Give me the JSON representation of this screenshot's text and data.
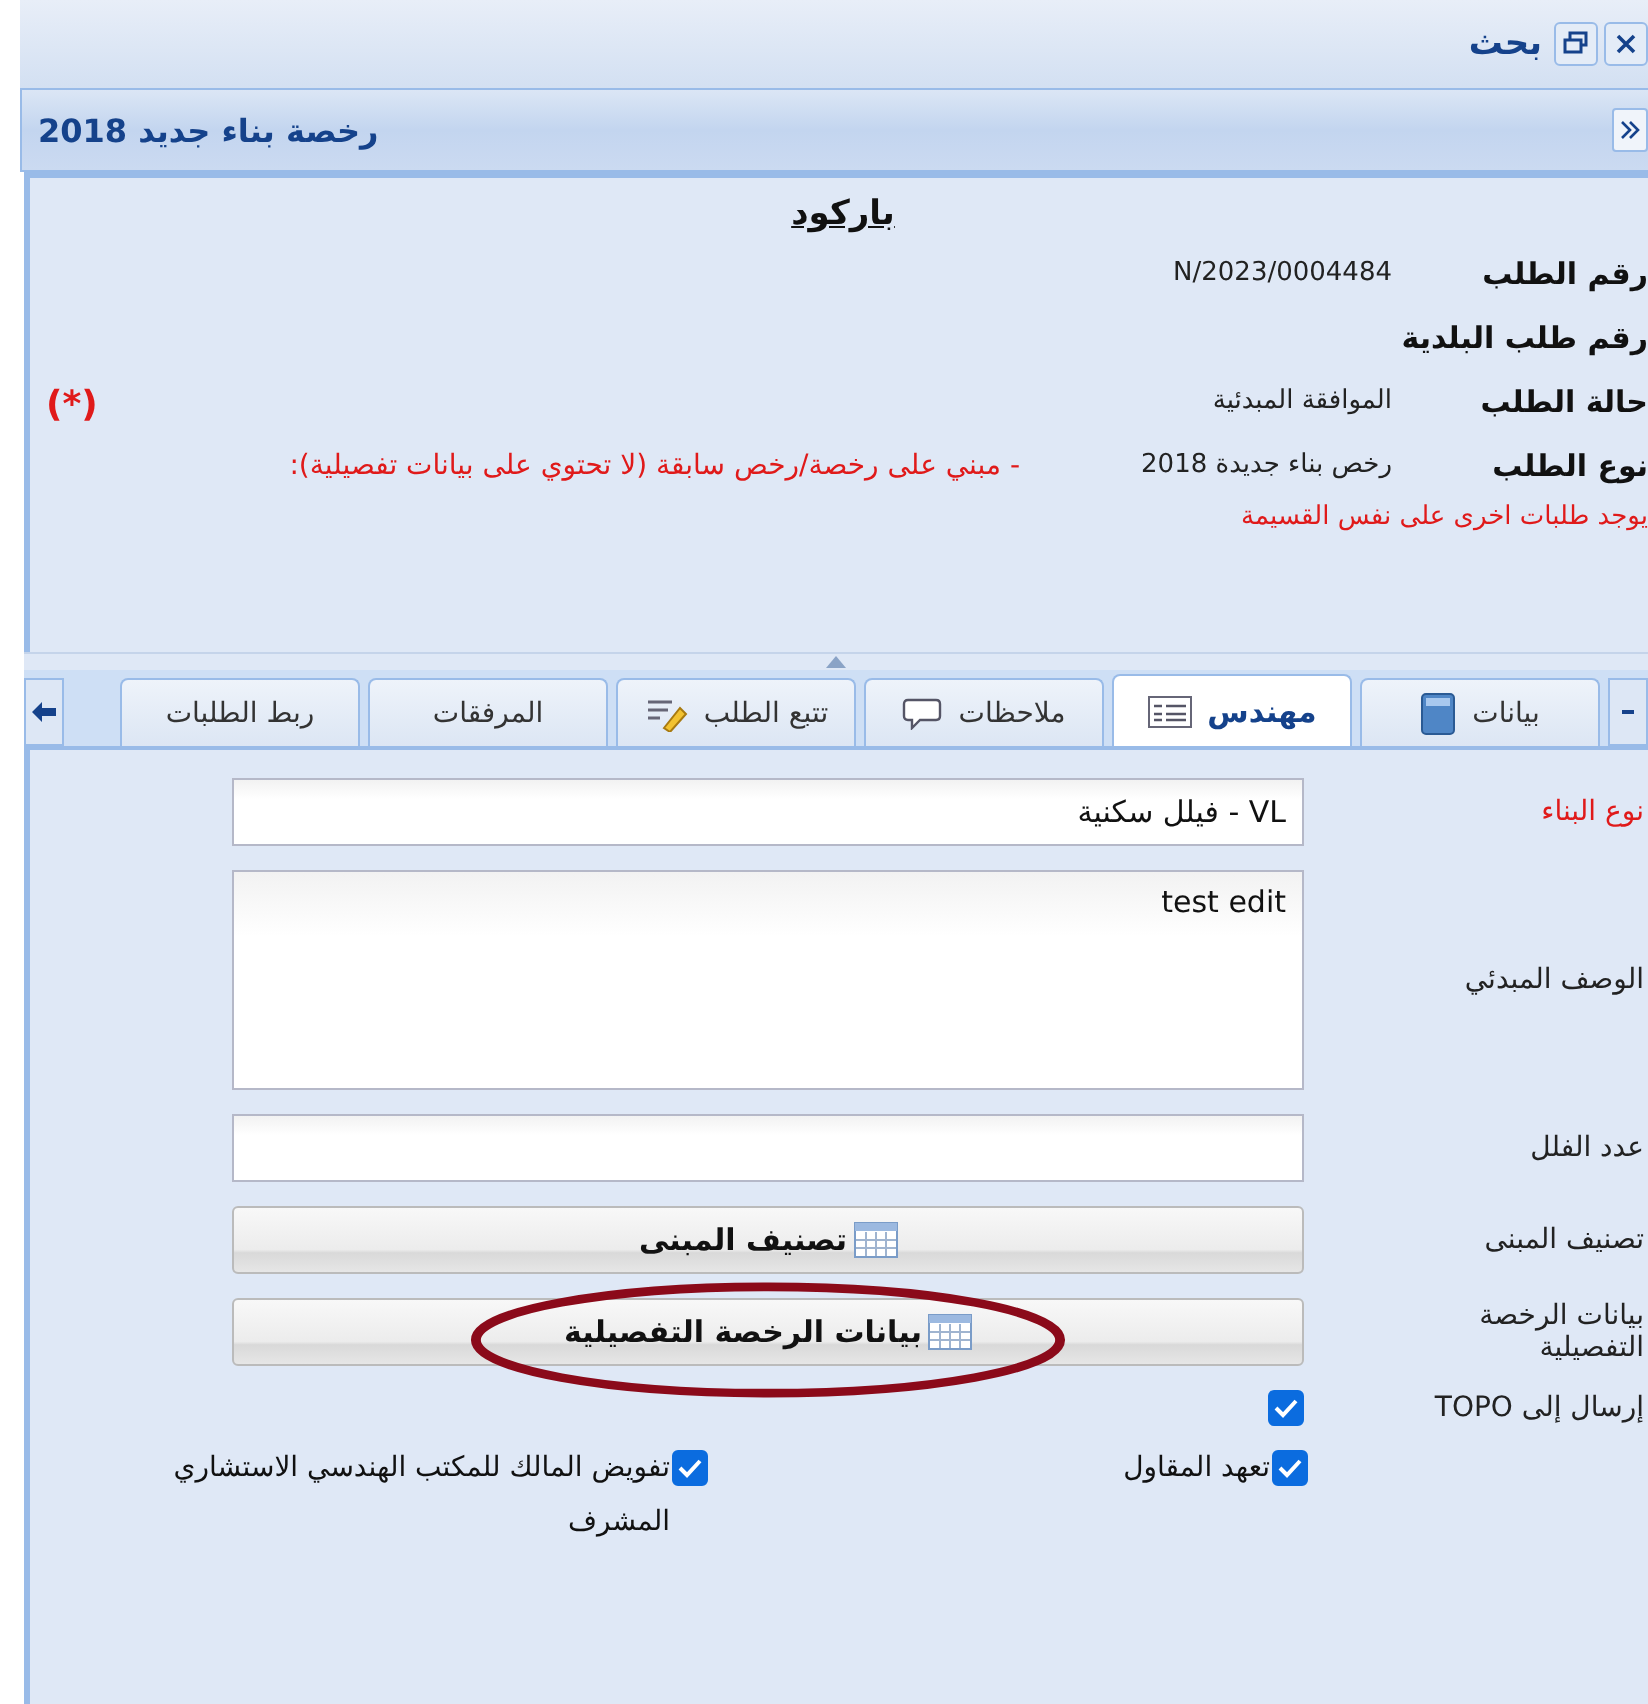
{
  "window": {
    "title": "بحث"
  },
  "panel": {
    "title": "رخصة بناء جديد 2018"
  },
  "info": {
    "heading": "باركود",
    "fields": [
      {
        "label": "رقم الطلب",
        "value": "N/2023/0004484"
      },
      {
        "label": "رقم طلب البلدية"
      },
      {
        "label": "حالة الطلب",
        "value": "الموافقة المبدئية",
        "marker": "(*)"
      },
      {
        "label": "نوع الطلب",
        "value": "رخص بناء جديدة 2018",
        "note": "- مبني على رخصة/رخص سابقة (لا تحتوي على بيانات تفصيلية):"
      }
    ],
    "warning": "يوجد طلبات اخرى على نفس القسيمة"
  },
  "tabs": [
    {
      "label": "بيانات",
      "kind": "book",
      "selected": false
    },
    {
      "label": "مهندس",
      "kind": "form",
      "selected": true
    },
    {
      "label": "ملاحظات",
      "kind": "bubble",
      "selected": false
    },
    {
      "label": "تتبع الطلب",
      "kind": "pencil",
      "selected": false
    },
    {
      "label": "المرفقات",
      "kind": "plain",
      "selected": false
    },
    {
      "label": "ربط الطلبات",
      "kind": "plain",
      "selected": false
    }
  ],
  "form": [
    {
      "kind": "text",
      "label": "نوع البناء",
      "required": true,
      "value": "VL - فيلل سكنية"
    },
    {
      "kind": "textarea",
      "label": "الوصف المبدئي",
      "required": false,
      "value": "test edit"
    },
    {
      "kind": "text",
      "label": "عدد الفلل",
      "required": false
    },
    {
      "kind": "button",
      "label": "تصنيف المبنى",
      "required": false,
      "button": "تصنيف المبنى"
    },
    {
      "kind": "button",
      "label": "بيانات الرخصة التفصيلية",
      "required": false,
      "button": "بيانات الرخصة التفصيلية",
      "circled": true
    },
    {
      "kind": "checkbox",
      "label": "إرسال إلى TOPO",
      "required": false,
      "checked": true
    }
  ],
  "checkboxes": [
    {
      "label": "تعهد المقاول",
      "checked": true
    },
    {
      "label": "تفويض المالك للمكتب الهندسي الاستشاري المشرف",
      "checked": true
    }
  ]
}
